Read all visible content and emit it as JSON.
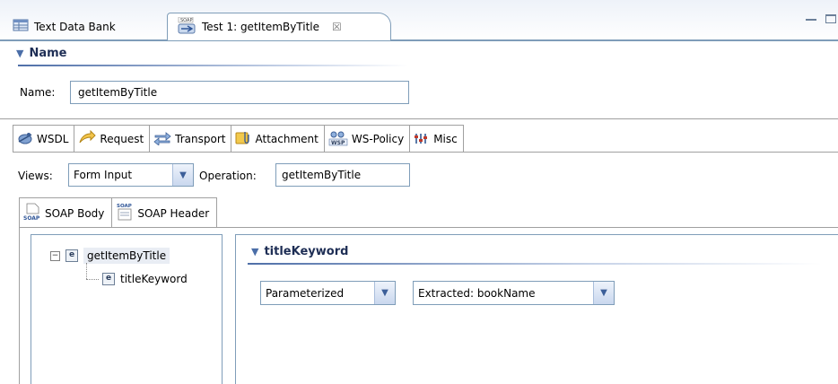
{
  "editor_tabs": [
    {
      "label": "Text Data Bank",
      "icon": "table-icon",
      "active": false
    },
    {
      "label": "Test 1: getItemByTitle",
      "icon": "soap-client-icon",
      "active": true,
      "close": "☒"
    }
  ],
  "name_section": {
    "title": "Name",
    "field_label": "Name:",
    "field_value": "getItemByTitle"
  },
  "request_tabs": [
    {
      "label": "WSDL",
      "icon": "wsdl-icon"
    },
    {
      "label": "Request",
      "icon": "request-icon"
    },
    {
      "label": "Transport",
      "icon": "transport-icon"
    },
    {
      "label": "Attachment",
      "icon": "attachment-icon"
    },
    {
      "label": "WS-Policy",
      "icon": "ws-policy-icon"
    },
    {
      "label": "Misc",
      "icon": "misc-icon"
    }
  ],
  "views": {
    "label": "Views:",
    "selected": "Form Input",
    "operation_label": "Operation:",
    "operation_value": "getItemByTitle"
  },
  "soap_tabs": [
    {
      "label": "SOAP Body",
      "icon": "soap-body-icon"
    },
    {
      "label": "SOAP Header",
      "icon": "soap-header-icon"
    }
  ],
  "tree": {
    "root": {
      "label": "getItemByTitle",
      "expander": "−",
      "badge": "e"
    },
    "child": {
      "label": "titleKeyword",
      "badge": "e"
    }
  },
  "detail": {
    "title": "titleKeyword",
    "mode_selected": "Parameterized",
    "value_selected": "Extracted: bookName"
  },
  "colors": {
    "border": "#7f9db9",
    "section_title": "#1e2e55",
    "accent": "#4f6fa8"
  }
}
